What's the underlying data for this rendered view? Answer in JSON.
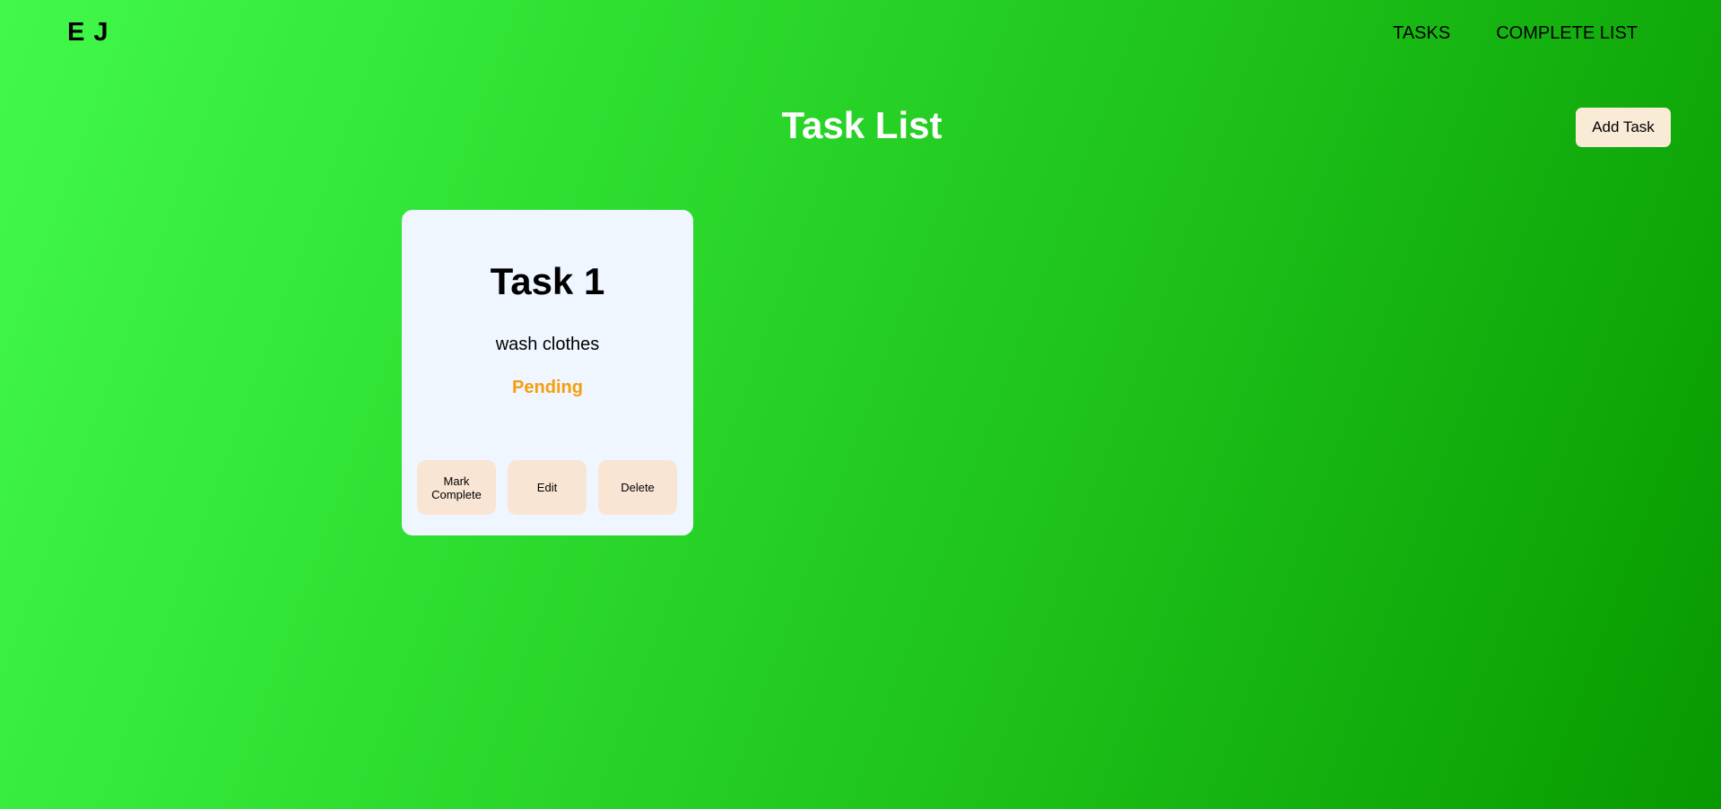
{
  "brand": "E J",
  "nav": {
    "items": [
      {
        "label": "TASKS"
      },
      {
        "label": "COMPLETE LIST"
      }
    ]
  },
  "page": {
    "title": "Task List",
    "add_task_label": "Add Task"
  },
  "tasks": [
    {
      "title": "Task 1",
      "description": "wash clothes",
      "status": "Pending",
      "status_color": "#f59e0b",
      "actions": {
        "mark_complete": "Mark Complete",
        "edit": "Edit",
        "delete": "Delete"
      }
    }
  ],
  "colors": {
    "background_start": "#42f94b",
    "background_end": "#079900",
    "card_background": "#eff6ff",
    "button_background": "#faebd7"
  }
}
